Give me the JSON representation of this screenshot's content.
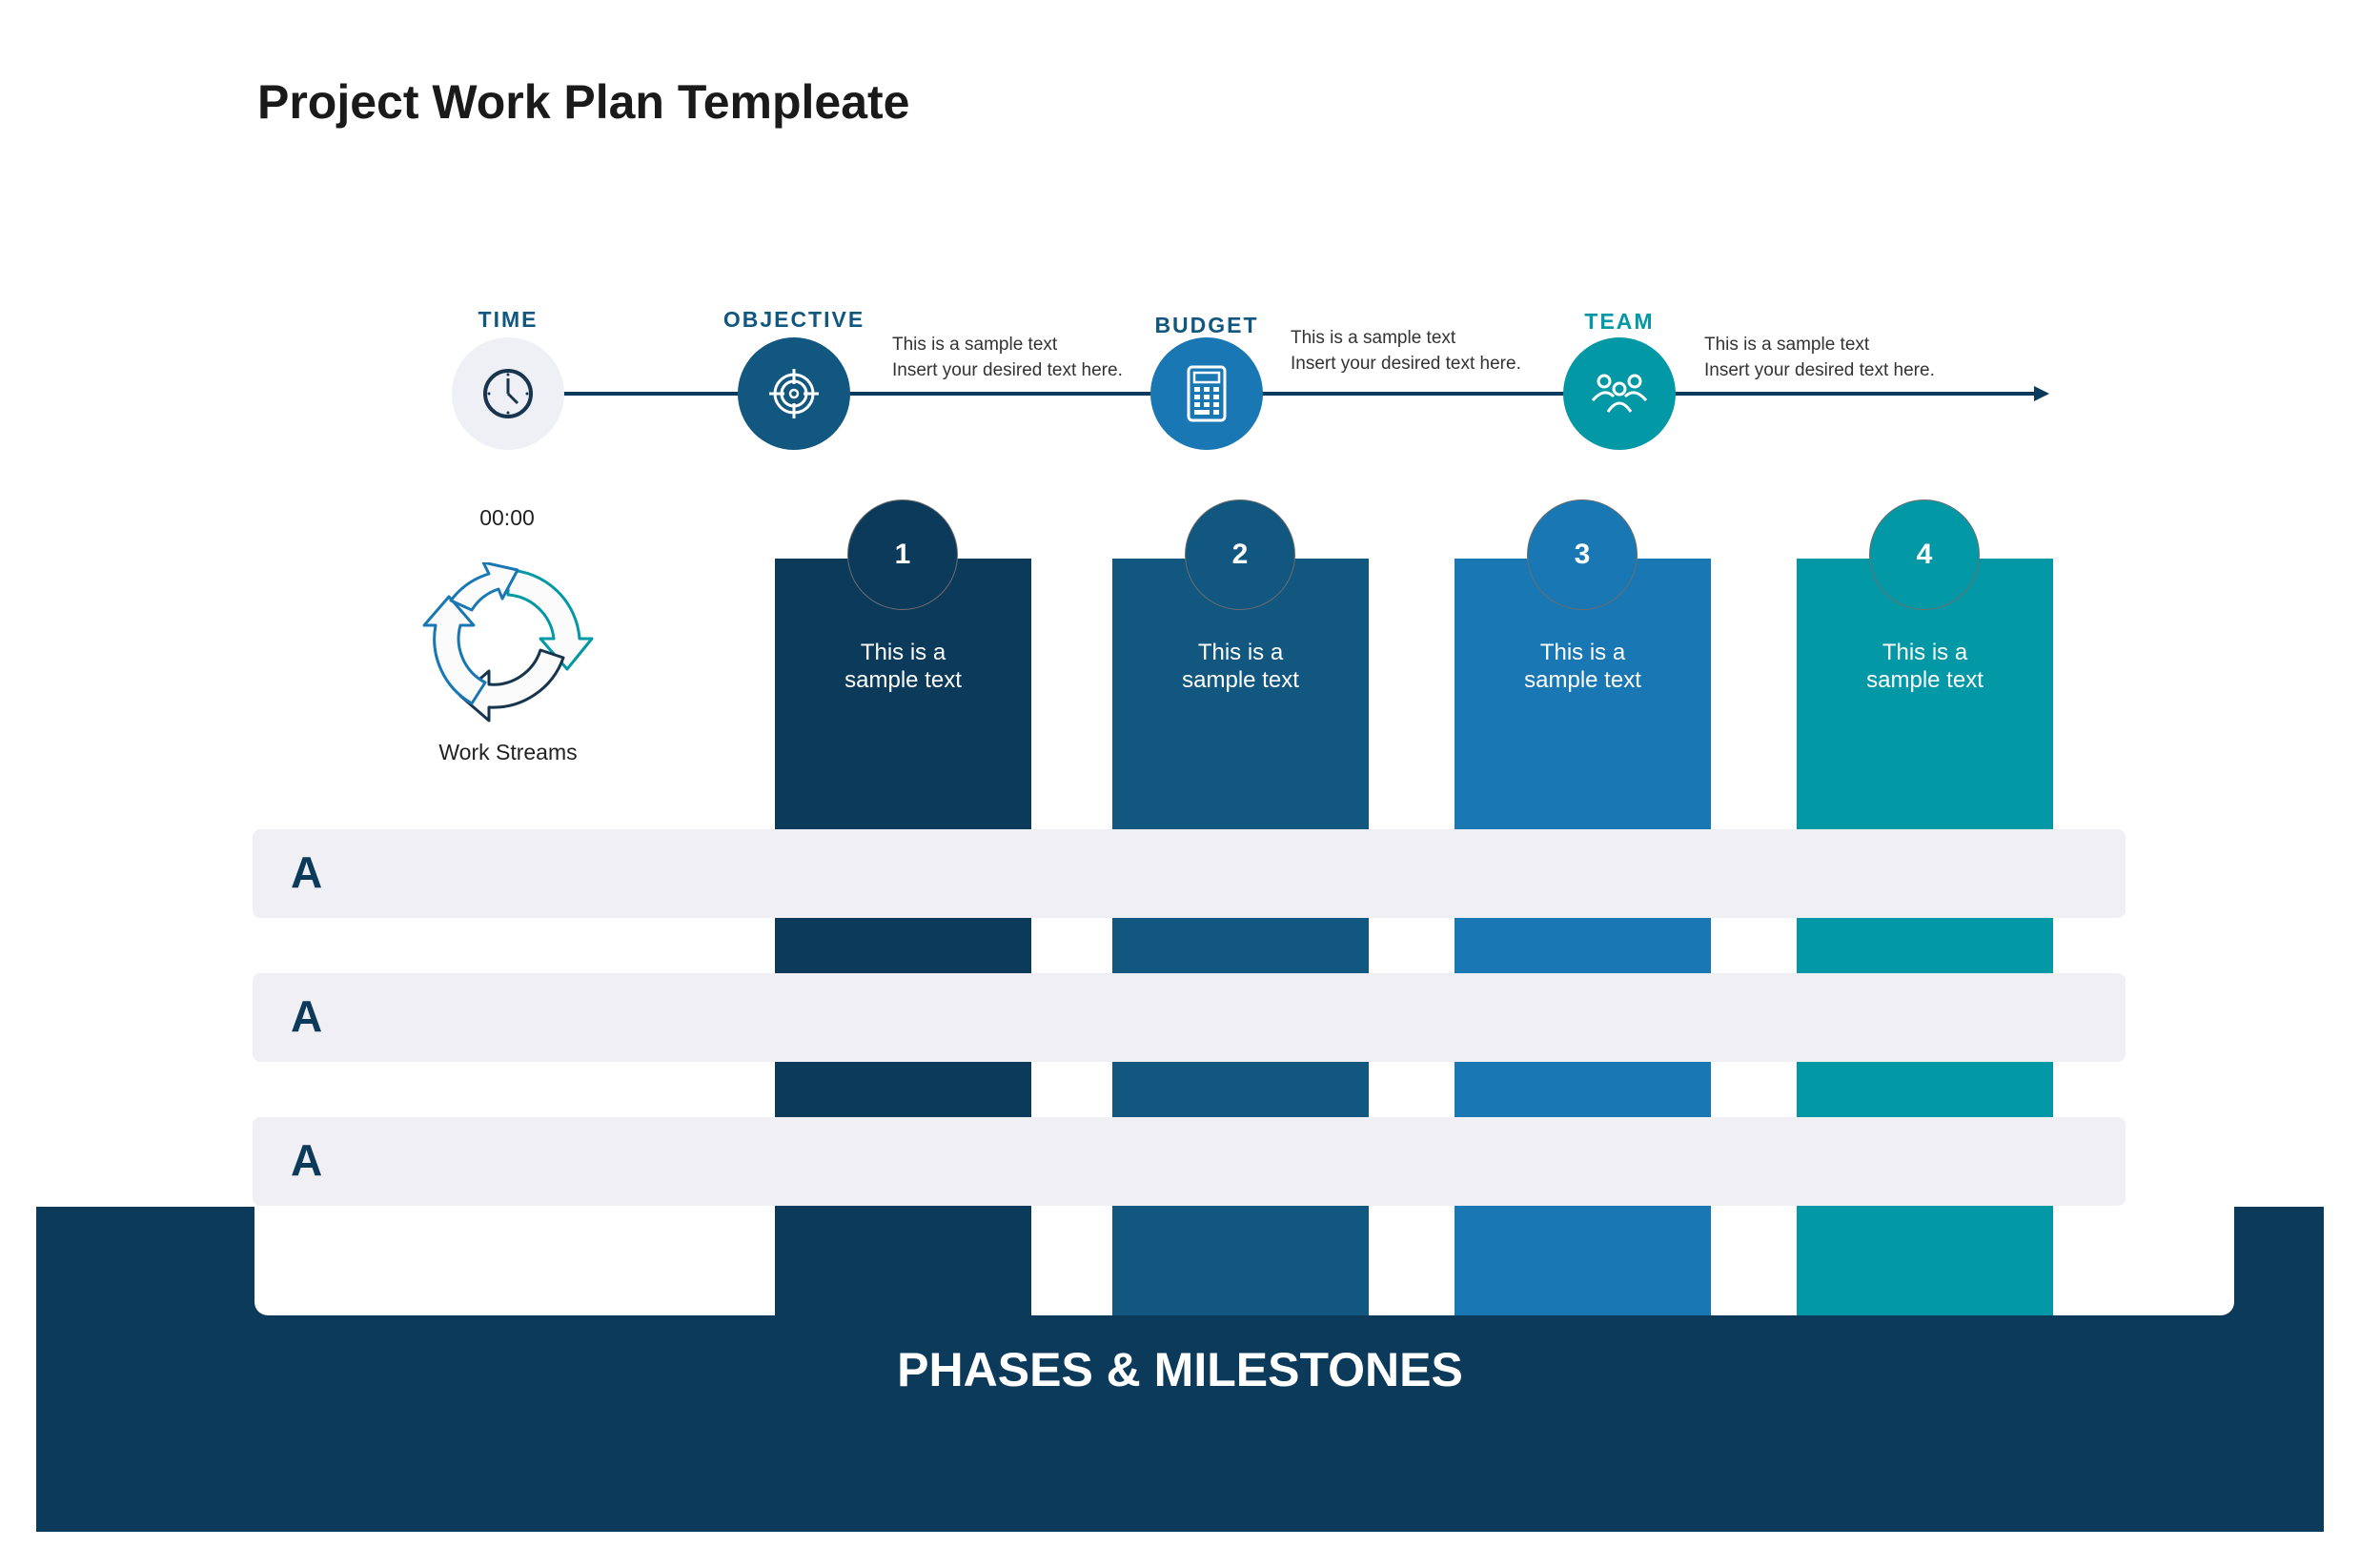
{
  "title": "Project Work Plan Templeate",
  "colors": {
    "navy": "#0c3a5a",
    "dark_blue": "#11577f",
    "blue": "#1977b4",
    "teal": "#0398a5",
    "row_bg": "#efeff4",
    "time_circle": "#eef0f6"
  },
  "timeline": {
    "time": {
      "label": "TIME",
      "icon": "clock-icon",
      "value": "00:00"
    },
    "milestones": [
      {
        "label": "OBJECTIVE",
        "icon": "target-icon",
        "line1": "This is a sample text",
        "line2": "Insert your desired text here."
      },
      {
        "label": "BUDGET",
        "icon": "calculator-icon",
        "line1": "This is a sample text",
        "line2": "Insert your desired text here."
      },
      {
        "label": "TEAM",
        "icon": "team-icon",
        "line1": "This is a sample text",
        "line2": "Insert your desired text here."
      }
    ]
  },
  "work_streams": {
    "icon": "cycle-arrows-icon",
    "label": "Work Streams"
  },
  "phases": [
    {
      "number": "1",
      "line1": "This is a",
      "line2": "sample text"
    },
    {
      "number": "2",
      "line1": "This is a",
      "line2": "sample text"
    },
    {
      "number": "3",
      "line1": "This is a",
      "line2": "sample text"
    },
    {
      "number": "4",
      "line1": "This is a",
      "line2": "sample text"
    }
  ],
  "rows": [
    {
      "label": "A"
    },
    {
      "label": "A"
    },
    {
      "label": "A"
    }
  ],
  "footer": {
    "label": "PHASES & MILESTONES"
  }
}
